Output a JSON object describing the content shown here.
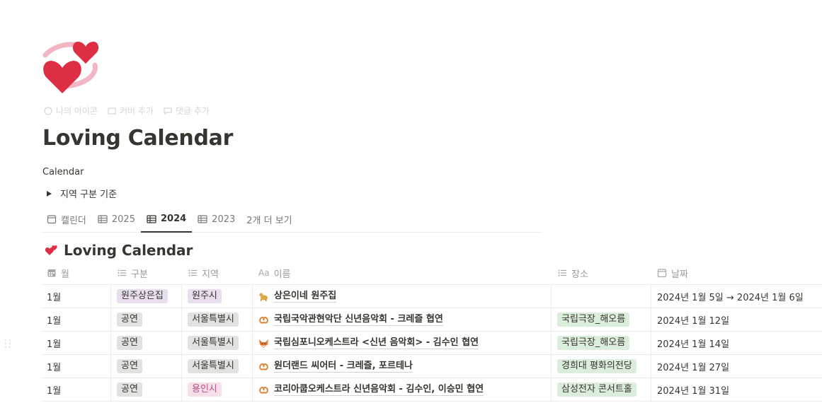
{
  "page": {
    "title": "Loving Calendar",
    "subtitle": "Calendar",
    "icon": "two-hearts-icon",
    "actions": [
      {
        "label": "나의 아이콘",
        "icon": "smile-icon"
      },
      {
        "label": "커버 추가",
        "icon": "image-icon"
      },
      {
        "label": "댓글 추가",
        "icon": "comment-icon"
      }
    ]
  },
  "toggle": {
    "label": "지역 구분 기준"
  },
  "tabs": [
    {
      "label": "캘린더",
      "icon": "calendar-icon",
      "active": false
    },
    {
      "label": "2025",
      "icon": "table-icon",
      "active": false
    },
    {
      "label": "2024",
      "icon": "table-icon",
      "active": true
    },
    {
      "label": "2023",
      "icon": "table-icon",
      "active": false
    },
    {
      "label": "2개 더 보기",
      "icon": "",
      "active": false
    }
  ],
  "database": {
    "title": "Loving Calendar",
    "icon": "two-hearts-icon",
    "columns": [
      {
        "label": "월",
        "icon": "calendar-grid-icon"
      },
      {
        "label": "구분",
        "icon": "list-icon"
      },
      {
        "label": "지역",
        "icon": "list-icon"
      },
      {
        "label": "이름",
        "icon": "text-aa-icon"
      },
      {
        "label": "장소",
        "icon": "list-icon"
      },
      {
        "label": "날짜",
        "icon": "calendar-icon"
      }
    ],
    "rows": [
      {
        "month": "1월",
        "category": "원주상은집",
        "region": "원주시",
        "name": "상은이네 원주집",
        "emoji": "dog-icon",
        "place": "",
        "date": "2024년 1월 5일 → 2024년 1월 6일"
      },
      {
        "month": "1월",
        "category": "공연",
        "region": "서울특별시",
        "name": "국립국악관현악단 신년음악회 - 크레즐 협연",
        "emoji": "pretzel-icon",
        "place": "국립극장_해오름",
        "date": "2024년 1월 12일"
      },
      {
        "month": "1월",
        "category": "공연",
        "region": "서울특별시",
        "name": "국립심포니오케스트라 <신년 음악회> - 김수인 협연",
        "emoji": "fox-icon",
        "place": "국립극장_해오름",
        "date": "2024년 1월 14일"
      },
      {
        "month": "1월",
        "category": "공연",
        "region": "서울특별시",
        "name": "원더랜드 씨어터 - 크레즐, 포르테나",
        "emoji": "pretzel-icon",
        "place": "경희대 평화의전당",
        "date": "2024년 1월 27일"
      },
      {
        "month": "1월",
        "category": "공연",
        "region": "용인시",
        "name": "코리아쿱오케스트라 신년음악회 - 김수인, 이승민 협연",
        "emoji": "pretzel-icon",
        "place": "삼성전자 콘서트홀",
        "date": "2024년 1월 31일"
      }
    ]
  },
  "colors": {
    "tag_purple": "#e8deee",
    "tag_gray": "#e3e2e0",
    "tag_pink": "#f5e0e9",
    "tag_pink_text": "#c14c8a",
    "tag_green": "#dbeddb",
    "heart": "#dd2e44"
  }
}
